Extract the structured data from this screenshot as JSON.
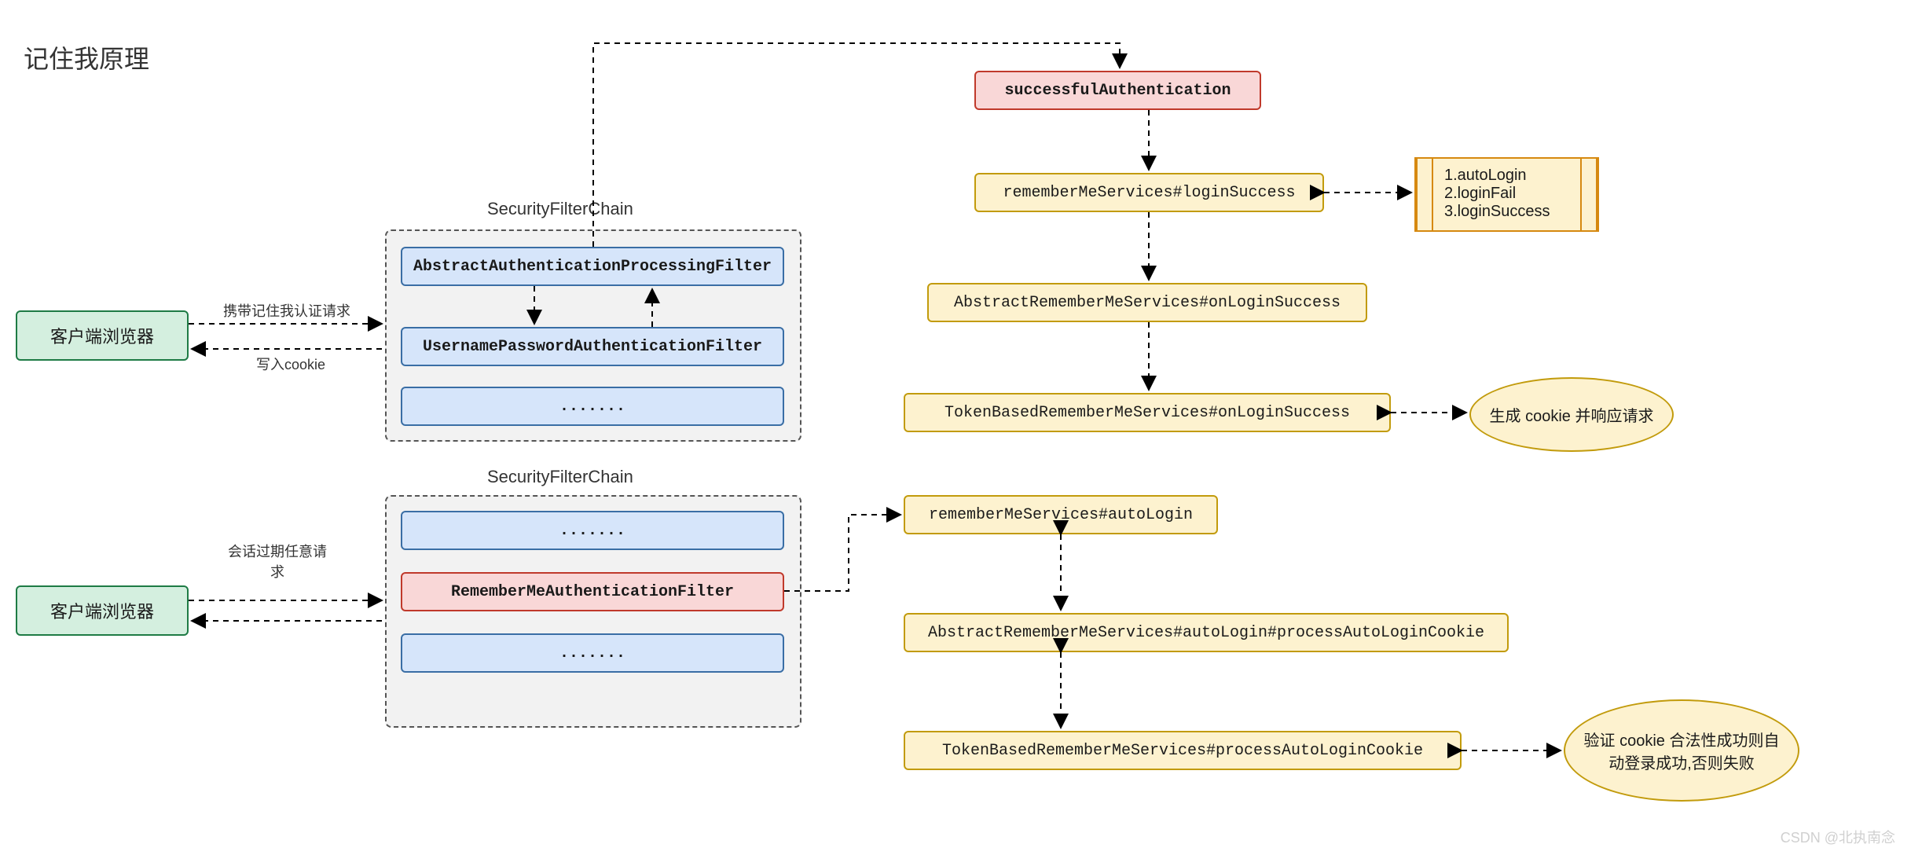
{
  "title": "记住我原理",
  "watermark": "CSDN @北执南念",
  "clients": {
    "top": "客户端浏览器",
    "bottom": "客户端浏览器"
  },
  "edge_labels": {
    "top_up": "携带记住我认证请求",
    "top_down": "写入cookie",
    "bottom": "会话过期任意请求"
  },
  "chain1": {
    "label": "SecurityFilterChain",
    "filter1": "AbstractAuthenticationProcessingFilter",
    "filter2": "UsernamePasswordAuthenticationFilter",
    "filter3": "......."
  },
  "chain2": {
    "label": "SecurityFilterChain",
    "filter1": ".......",
    "filter2": "RememberMeAuthenticationFilter",
    "filter3": "......."
  },
  "flow": {
    "successfulAuth": "successfulAuthentication",
    "rmLoginSuccess": "rememberMeServices#loginSuccess",
    "absOnLoginSuccess": "AbstractRememberMeServices#onLoginSuccess",
    "tokOnLoginSuccess": "TokenBasedRememberMeServices#onLoginSuccess",
    "rmAutoLogin": "rememberMeServices#autoLogin",
    "absAutoLogin": "AbstractRememberMeServices#autoLogin#processAutoLoginCookie",
    "tokAutoLogin": "TokenBasedRememberMeServices#processAutoLoginCookie"
  },
  "note": {
    "line1": "1.autoLogin",
    "line2": "2.loginFail",
    "line3": "3.loginSuccess"
  },
  "ellipse": {
    "cookieGen": "生成 cookie 并响应请求",
    "cookieVerify": "验证 cookie 合法性成功则自动登录成功,否则失败"
  }
}
